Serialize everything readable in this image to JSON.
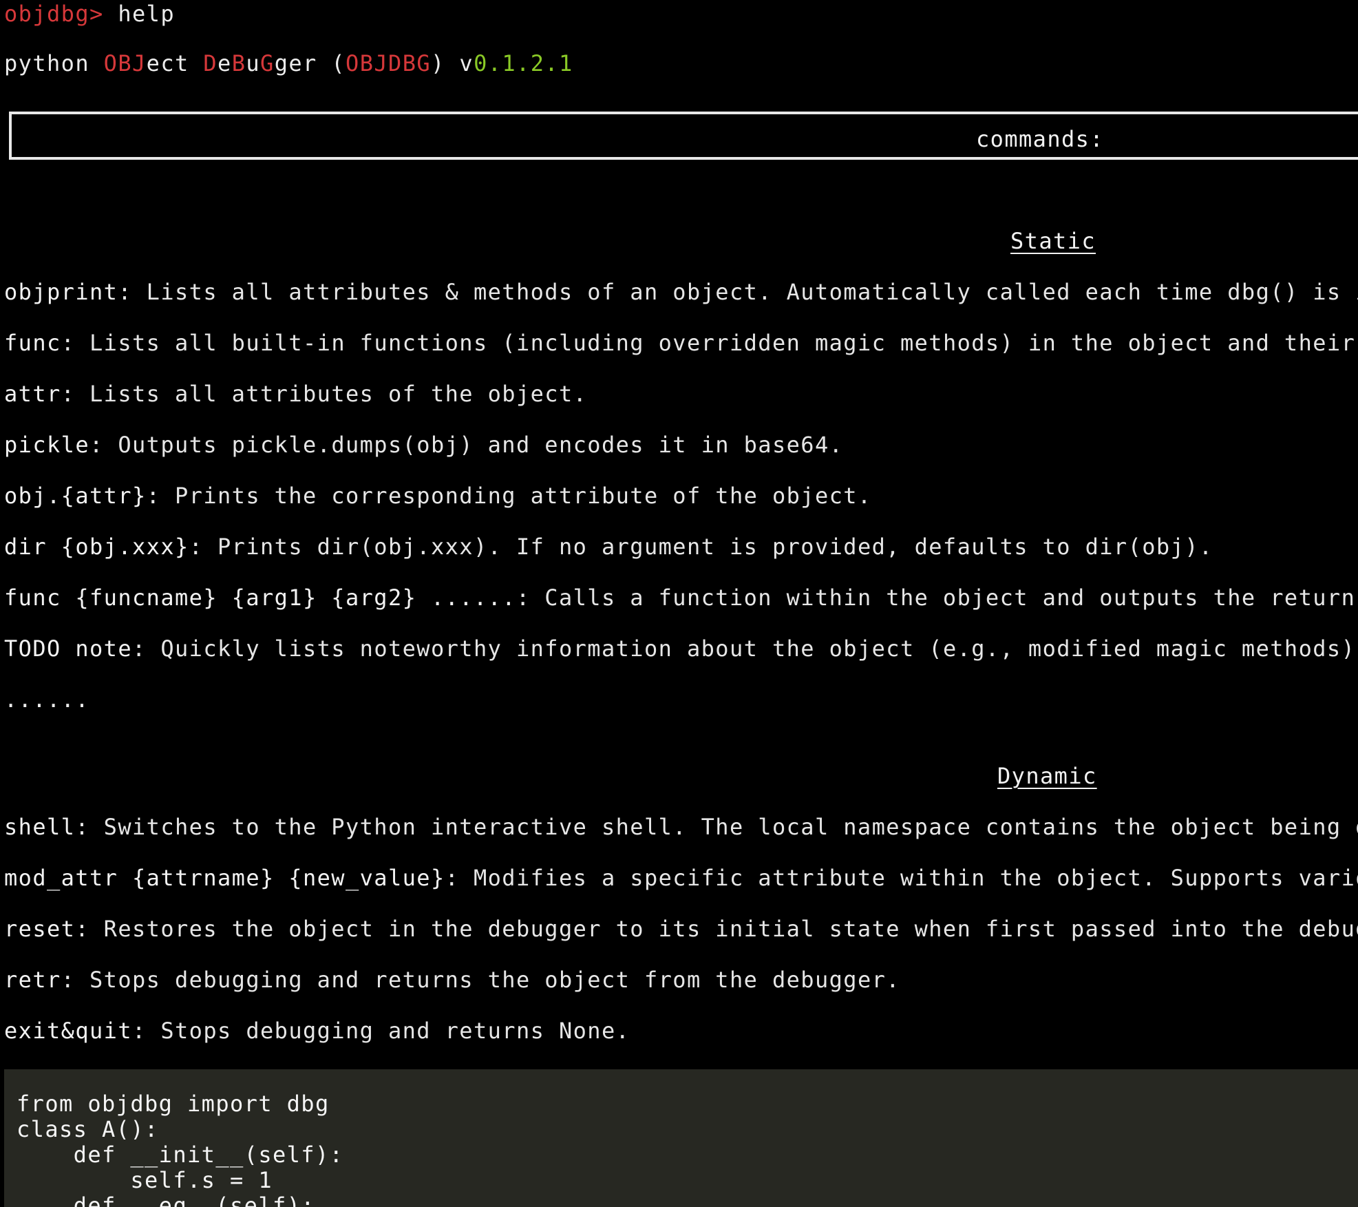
{
  "prompt": {
    "label": "objdbg>",
    "input": "help"
  },
  "banner": {
    "w1": "python ",
    "w2a": "OBJ",
    "w2b": "ect ",
    "w3a": "D",
    "w3b": "e",
    "w3c": "B",
    "w3d": "u",
    "w3e": "G",
    "w3f": "ger ",
    "p_open": "(",
    "abbr": "OBJDBG",
    "p_close": ") ",
    "v": "v",
    "version": "0.1.2.1"
  },
  "commands_title": "commands:",
  "static": {
    "heading": "Static",
    "items": [
      {
        "name": "objprint",
        "desc": ": Lists all attributes & methods of an object. Automatically called each time dbg() is invoked."
      },
      {
        "name": "func",
        "desc": ": Lists all built-in functions (including overridden magic methods) in the object and their paramete"
      },
      {
        "name": "attr",
        "desc": ": Lists all attributes of the object."
      },
      {
        "name": "pickle",
        "desc": ": Outputs pickle.dumps(obj) and encodes it in base64."
      },
      {
        "name": "obj.{attr}",
        "desc": ": Prints the corresponding attribute of the object."
      },
      {
        "name": "dir {obj.xxx}",
        "desc": ": Prints dir(obj.xxx). If no argument is provided, defaults to dir(obj)."
      },
      {
        "name": "func {funcname} {arg1} {arg2} ......",
        "desc": ": Calls a function within the object and outputs the return value."
      },
      {
        "name": "TODO note",
        "desc": ": Quickly lists noteworthy information about the object (e.g., modified magic methods)."
      }
    ],
    "ellipsis": "......"
  },
  "dynamic": {
    "heading": "Dynamic",
    "items": [
      {
        "name": "shell",
        "desc": ": Switches to the Python interactive shell. The local namespace contains the object being debugged."
      },
      {
        "name": "mod_attr {attrname} {new_value}",
        "desc": ": Modifies a specific attribute within the object. Supports various neste"
      },
      {
        "name": "reset",
        "desc": ": Restores the object in the debugger to its initial state when first passed into the debugger."
      },
      {
        "name": "retr",
        "desc": ": Stops debugging and returns the object from the debugger."
      },
      {
        "name": "exit&quit",
        "desc": ": Stops debugging and returns None."
      }
    ]
  },
  "code": {
    "lines": [
      "from objdbg import dbg",
      "class A():",
      "    def __init__(self):",
      "        self.s = 1",
      "    def __eq__(self):"
    ]
  },
  "colors": {
    "background": "#000000",
    "text": "#ececec",
    "accent_red": "#d6383a",
    "version_green": "#8ac926",
    "code_background": "#272822"
  }
}
